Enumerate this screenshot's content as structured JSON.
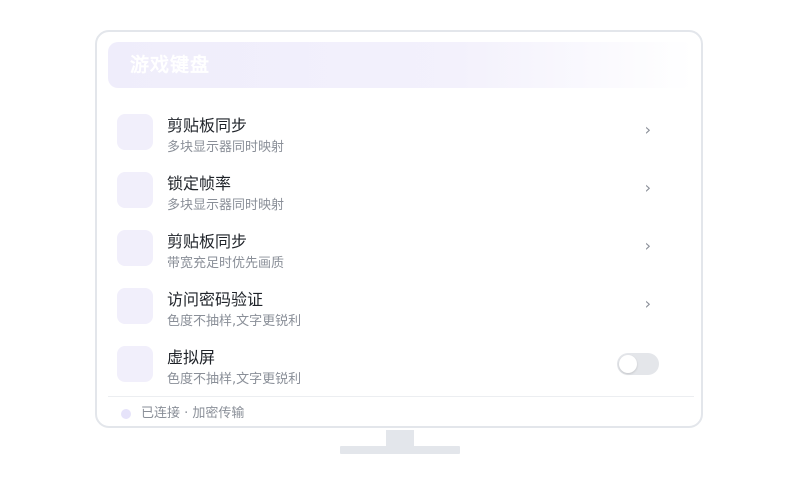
{
  "header": {
    "title": "游戏键盘"
  },
  "items": [
    {
      "title": "剪贴板同步",
      "subtitle": "多块显示器同时映射",
      "control": "chevron"
    },
    {
      "title": "锁定帧率",
      "subtitle": "多块显示器同时映射",
      "control": "chevron"
    },
    {
      "title": "剪贴板同步",
      "subtitle": "带宽充足时优先画质",
      "control": "chevron"
    },
    {
      "title": "访问密码验证",
      "subtitle": "色度不抽样,文字更锐利",
      "control": "chevron"
    },
    {
      "title": "虚拟屏",
      "subtitle": "色度不抽样,文字更锐利",
      "control": "toggle",
      "toggle_on": false
    }
  ],
  "chevron_glyph": "›",
  "status": {
    "text": "已连接 · 加密传输"
  },
  "colors": {
    "accent_light": "#efedfb",
    "text_primary": "#1f2329",
    "text_secondary": "#8a8f98"
  }
}
